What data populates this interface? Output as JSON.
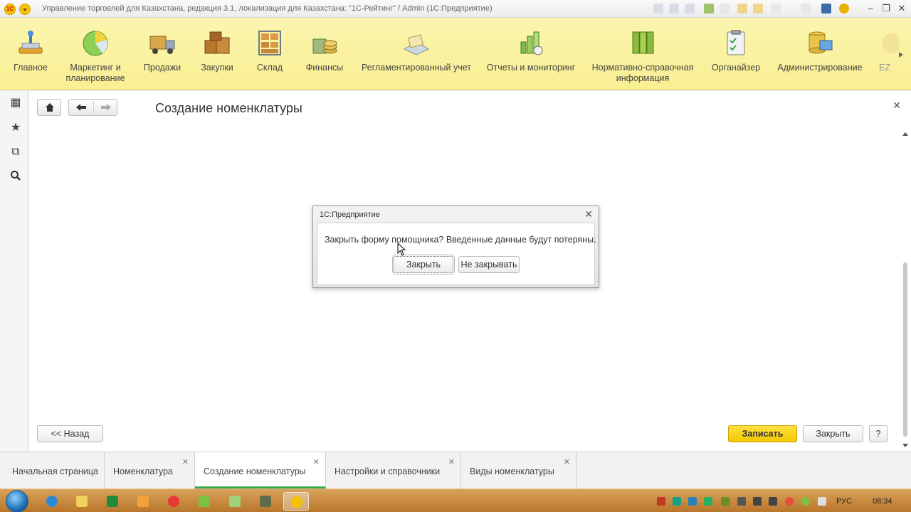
{
  "window": {
    "title": "Управление торговлей для Казахстана, редакция 3.1, локализация для Казахстана: \"1С-Рейтинг\" / Admin  (1С:Предприятие)",
    "logo_text": "1С"
  },
  "ribbon": {
    "items": [
      {
        "label": "Главное",
        "icon": "home-desk-icon"
      },
      {
        "label": "Маркетинг и\nпланирование",
        "icon": "pie-chart-icon"
      },
      {
        "label": "Продажи",
        "icon": "truck-icon"
      },
      {
        "label": "Закупки",
        "icon": "boxes-icon"
      },
      {
        "label": "Склад",
        "icon": "warehouse-shelf-icon"
      },
      {
        "label": "Финансы",
        "icon": "coins-icon"
      },
      {
        "label": "Регламентированный учет",
        "icon": "ledger-icon"
      },
      {
        "label": "Отчеты и мониторинг",
        "icon": "bar-chart-icon"
      },
      {
        "label": "Нормативно-справочная\nинформация",
        "icon": "binders-icon"
      },
      {
        "label": "Органайзер",
        "icon": "clipboard-icon"
      },
      {
        "label": "Администрирование",
        "icon": "database-computer-icon"
      },
      {
        "label": "EZ",
        "icon": "partial-icon"
      }
    ]
  },
  "form": {
    "title": "Создание номенклатуры",
    "back_button": "<< Назад",
    "save_button": "Записать",
    "close_button": "Закрыть",
    "help_button": "?"
  },
  "dialog": {
    "title": "1С:Предприятие",
    "message": "Закрыть форму помощника? Введенные данные будут потеряны.",
    "confirm": "Закрыть",
    "cancel": "Не закрывать"
  },
  "tabs": [
    {
      "label": "Начальная страница",
      "closable": false
    },
    {
      "label": "Номенклатура",
      "closable": true
    },
    {
      "label": "Создание номенклатуры",
      "closable": true,
      "active": true
    },
    {
      "label": "Настройки и справочники",
      "closable": true
    },
    {
      "label": "Виды номенклатуры",
      "closable": true
    }
  ],
  "taskbar": {
    "language": "РУС",
    "time": "08:34"
  }
}
